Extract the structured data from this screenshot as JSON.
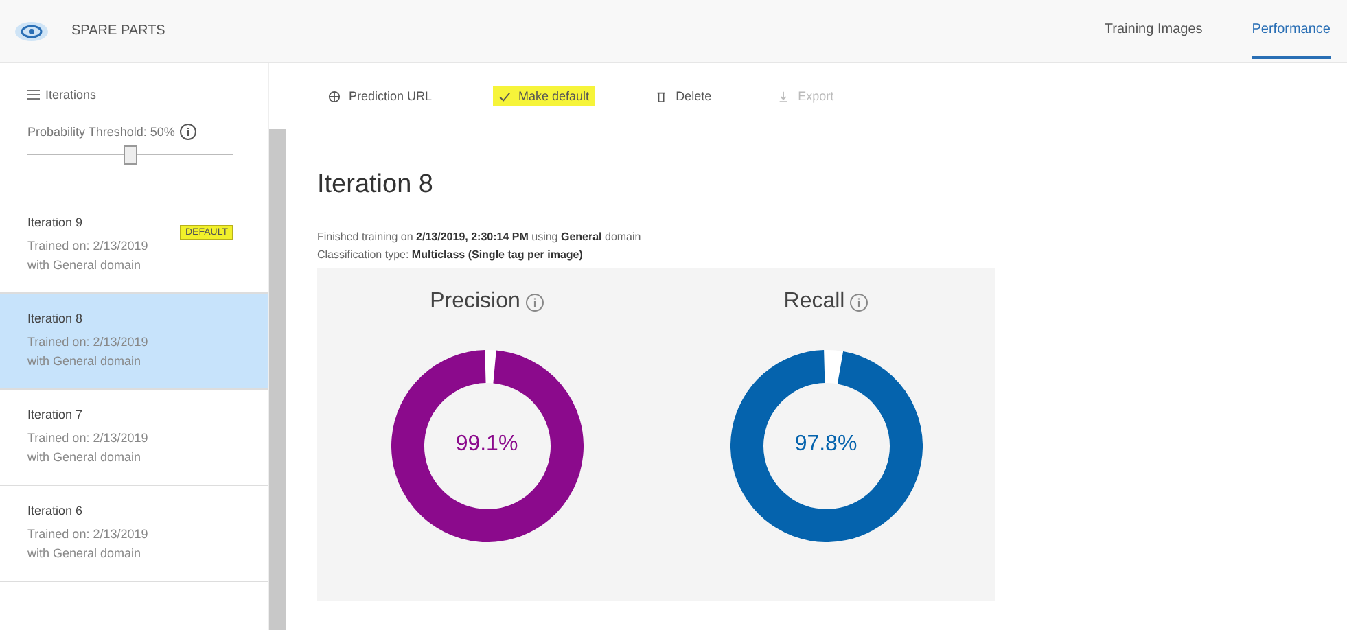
{
  "header": {
    "title": "SPARE PARTS",
    "tabs": [
      {
        "label": "Training Images",
        "selected": false
      },
      {
        "label": "Performance",
        "selected": true
      }
    ]
  },
  "sidebar": {
    "heading": "Iterations",
    "threshold": {
      "label": "Probability Threshold: 50%",
      "level": 0.5
    },
    "items": [
      {
        "title": "Iteration 9",
        "line1": "Trained on: 2/13/2019",
        "line2": "with General domain",
        "badge": "DEFAULT",
        "selected": false
      },
      {
        "title": "Iteration 8",
        "line1": "Trained on: 2/13/2019",
        "line2": "with General domain",
        "selected": true
      },
      {
        "title": "Iteration 7",
        "line1": "Trained on: 2/13/2019",
        "line2": "with General domain",
        "selected": false
      },
      {
        "title": "Iteration 6",
        "line1": "Trained on: 2/13/2019",
        "line2": "with General domain",
        "selected": false
      }
    ]
  },
  "toolbar": [
    {
      "kind": "globe",
      "label": "Prediction URL",
      "disabled": false,
      "highlighted": false
    },
    {
      "kind": "check",
      "label": "Make default",
      "disabled": false,
      "highlighted": true
    },
    {
      "kind": "trash",
      "label": "Delete",
      "disabled": false,
      "highlighted": false
    },
    {
      "kind": "download",
      "label": "Export",
      "disabled": true,
      "highlighted": false
    }
  ],
  "main": {
    "title": "Iteration 8",
    "info1": "Finished training on **2/13/2019, 2:30:14 PM** using **General** domain",
    "info2": "Classification type: **Multiclass (Single tag per image)**",
    "metrics": [
      {
        "title": "Precision",
        "reading": "99.1%",
        "level": 0.991,
        "color": "#8b0a8c"
      },
      {
        "title": "Recall",
        "reading": "97.8%",
        "level": 0.978,
        "color": "#0563ad"
      }
    ]
  }
}
